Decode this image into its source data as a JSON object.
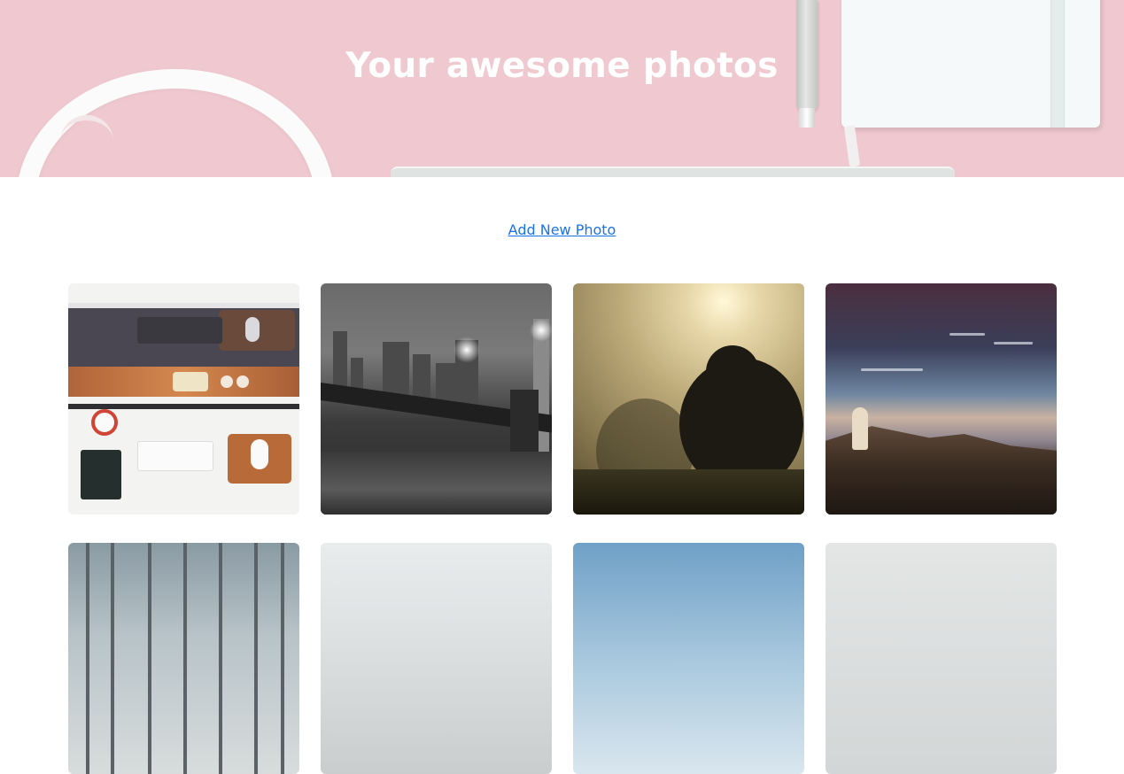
{
  "hero": {
    "title": "Your awesome photos",
    "background_color": "#efc9cf"
  },
  "actions": {
    "add_photo_label": "Add New Photo",
    "link_color": "#1a73e8"
  },
  "gallery": {
    "photos": [
      {
        "name": "photo-desk-flatlay"
      },
      {
        "name": "photo-city-bridge-night"
      },
      {
        "name": "photo-foggy-tree"
      },
      {
        "name": "photo-mountain-sunset"
      },
      {
        "name": "photo-winter-forest"
      },
      {
        "name": "photo-misty-landscape"
      },
      {
        "name": "photo-blue-sky"
      },
      {
        "name": "photo-grey-sky"
      }
    ]
  }
}
